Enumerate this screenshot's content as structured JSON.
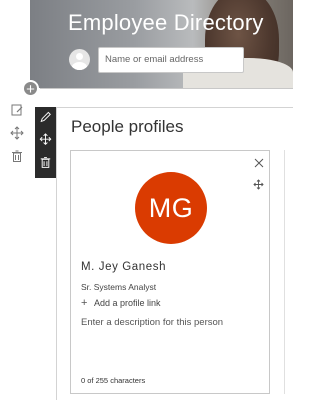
{
  "banner": {
    "title": "Employee Directory",
    "search_placeholder": "Name or email address"
  },
  "section": {
    "title": "People profiles"
  },
  "profile": {
    "initials": "MG",
    "initials_color": "#da3b01",
    "name": "M. Jey Ganesh",
    "job_title": "Sr. Systems Analyst",
    "add_link_label": "Add a profile link",
    "description_placeholder": "Enter a description for this person",
    "char_count": "0 of 255 characters"
  },
  "icons": {
    "section_tools": [
      "edit-section-icon",
      "move-section-icon",
      "delete-section-icon"
    ],
    "webpart_tools": [
      "edit-webpart-icon",
      "move-webpart-icon",
      "delete-webpart-icon"
    ]
  }
}
